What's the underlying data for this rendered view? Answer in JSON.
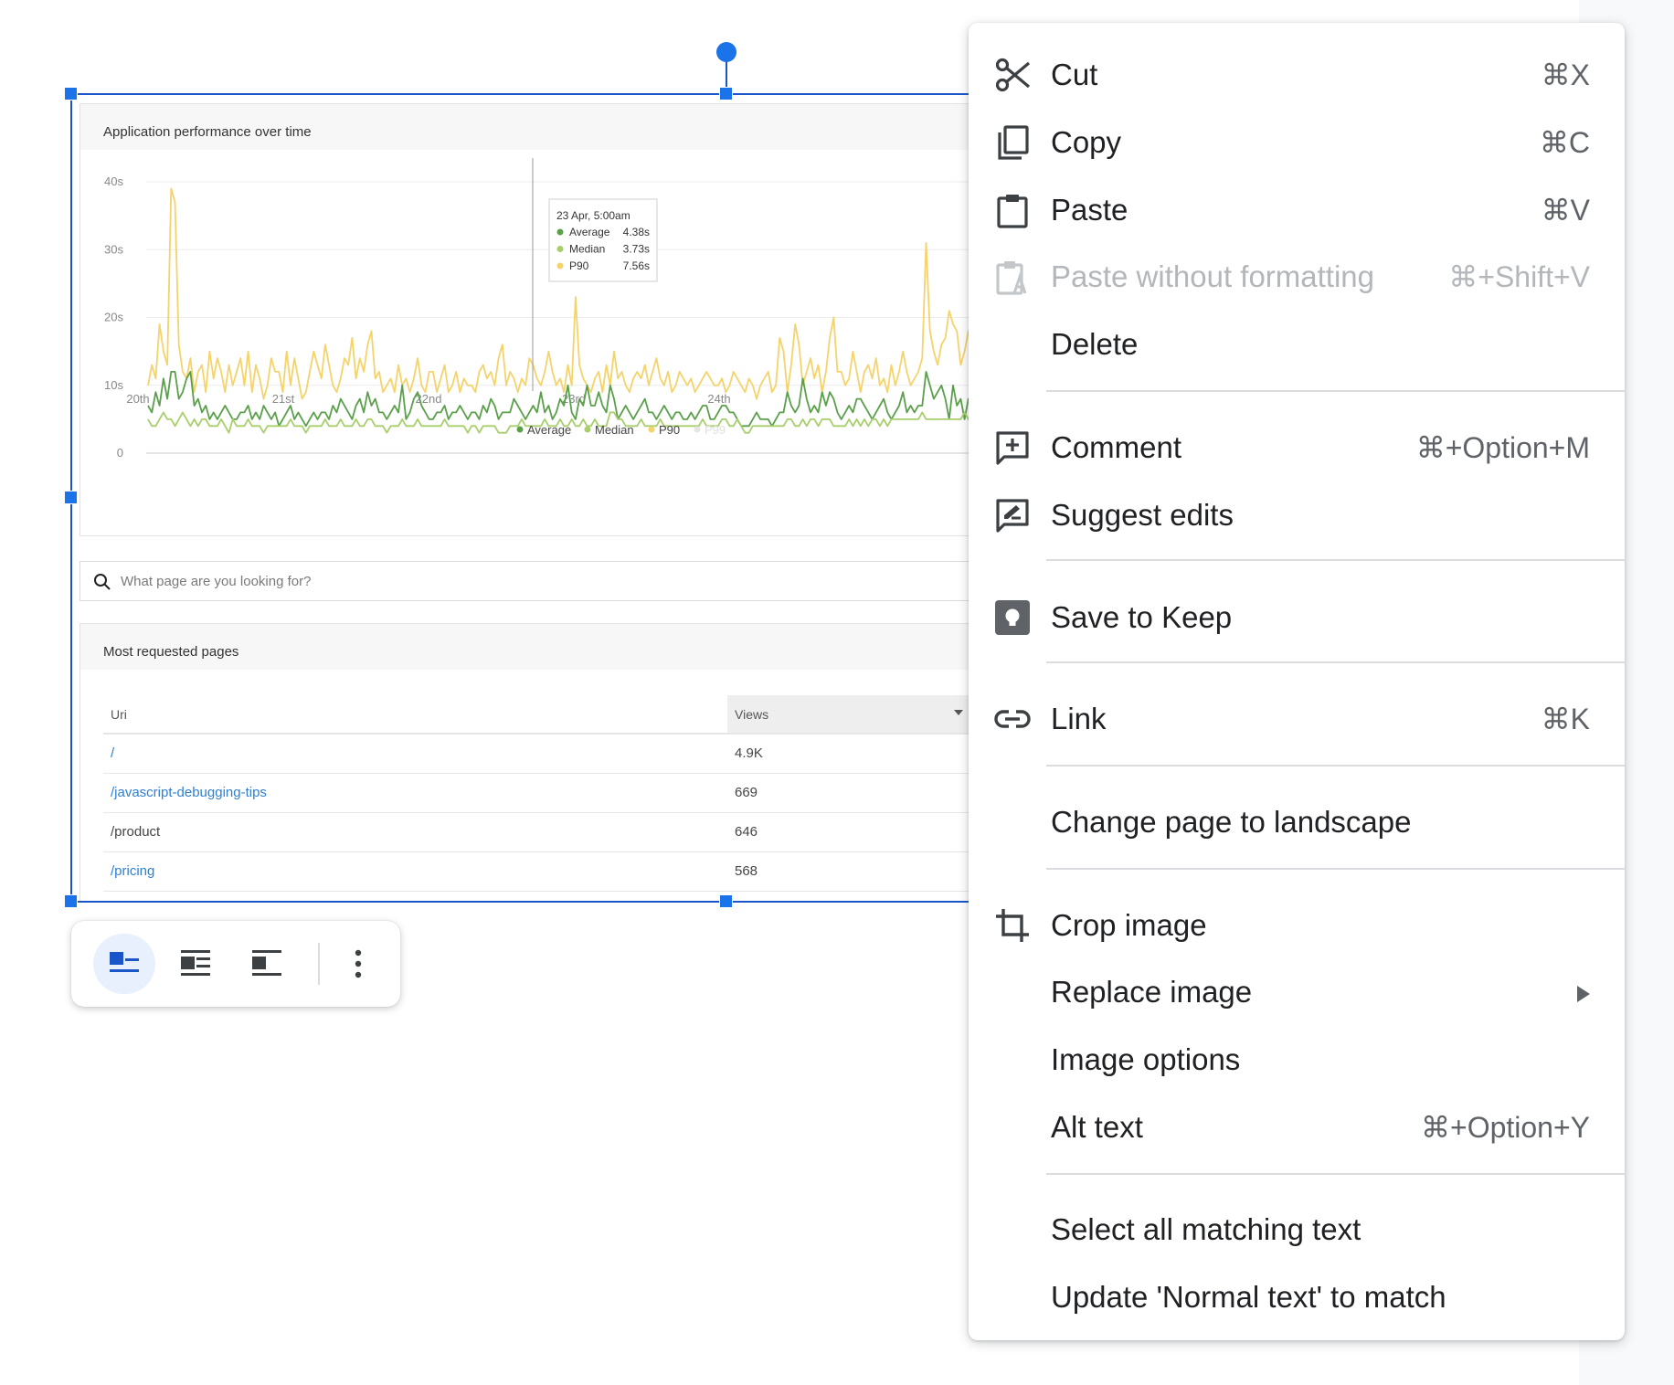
{
  "embedded_image": {
    "chart_card": {
      "title": "Application performance over time",
      "chart_data": {
        "type": "line",
        "x_ticks": [
          "20th",
          "21st",
          "22nd",
          "23rd",
          "24th"
        ],
        "y_ticks": [
          "0",
          "10s",
          "20s",
          "30s",
          "40s"
        ],
        "ylim": [
          0,
          40
        ],
        "grid": true,
        "legend_position": "bottom-center",
        "legend": [
          "Average",
          "Median",
          "P90",
          "P99"
        ],
        "series": [
          {
            "name": "P90",
            "color": "#f5d36b",
            "values": [
              10,
              13,
              11,
              19,
              15,
              13,
              39,
              37,
              16,
              12,
              11,
              14,
              9,
              12,
              13,
              9,
              15,
              11,
              14,
              12,
              9,
              13,
              10,
              12,
              14,
              10,
              15,
              9,
              13,
              11,
              8,
              10,
              14,
              12,
              12,
              9,
              15,
              10,
              14,
              11,
              8,
              9,
              12,
              15,
              13,
              11,
              16,
              13,
              10,
              9,
              11,
              14,
              13,
              17,
              11,
              14,
              12,
              16,
              18,
              11,
              12,
              9,
              10,
              11,
              9,
              13,
              10,
              11,
              9,
              11,
              14,
              10,
              9,
              12,
              12,
              9,
              11,
              13,
              9,
              10,
              12,
              9,
              11,
              10,
              10,
              9,
              12,
              13,
              11,
              12,
              10,
              14,
              16,
              10,
              12,
              11,
              9,
              11,
              10,
              14,
              13,
              11,
              10,
              12,
              15,
              12,
              10,
              11,
              9,
              13,
              10,
              23,
              13,
              11,
              10,
              9,
              11,
              12,
              9,
              13,
              10,
              15,
              11,
              12,
              10,
              9,
              11,
              12,
              11,
              13,
              10,
              12,
              14,
              11,
              10,
              12,
              9,
              10,
              12,
              11,
              10,
              11,
              9,
              10,
              11,
              12,
              11,
              10,
              10,
              11,
              9,
              10,
              12,
              11,
              10,
              9,
              11,
              10,
              8,
              10,
              11,
              12,
              9,
              10,
              17,
              15,
              9,
              13,
              19,
              16,
              10,
              12,
              14,
              11,
              13,
              9,
              12,
              17,
              20,
              12,
              12,
              10,
              11,
              15,
              12,
              9,
              12,
              13,
              11,
              14,
              10,
              11,
              9,
              13,
              10,
              12,
              15,
              12,
              10,
              11,
              12,
              14,
              31,
              18,
              15,
              13,
              16,
              17,
              21,
              19,
              18,
              13,
              15,
              18,
              15,
              16,
              19,
              14,
              20,
              18,
              12,
              12,
              17,
              13
            ]
          },
          {
            "name": "Average",
            "color": "#5aa04a",
            "values": [
              7,
              6,
              9,
              7,
              11,
              8,
              12,
              12,
              8,
              9,
              11,
              12,
              7,
              8,
              6,
              7,
              5,
              6,
              5,
              6,
              7,
              6,
              5,
              5,
              6,
              6,
              7,
              5,
              6,
              5,
              7,
              6,
              5,
              6,
              4,
              5,
              6,
              7,
              5,
              6,
              5,
              4,
              5,
              6,
              5,
              6,
              6,
              5,
              7,
              6,
              8,
              7,
              6,
              5,
              7,
              8,
              6,
              9,
              7,
              8,
              6,
              6,
              5,
              6,
              7,
              6,
              10,
              5,
              6,
              8,
              9,
              7,
              6,
              5,
              5,
              6,
              6,
              7,
              5,
              6,
              6,
              7,
              6,
              5,
              6,
              6,
              5,
              7,
              6,
              8,
              7,
              5,
              6,
              6,
              6,
              8,
              7,
              6,
              5,
              6,
              7,
              6,
              9,
              6,
              7,
              5,
              6,
              8,
              7,
              10,
              6,
              5,
              8,
              7,
              10,
              7,
              7,
              9,
              7,
              6,
              10,
              8,
              5,
              6,
              7,
              6,
              5,
              6,
              7,
              8,
              6,
              6,
              5,
              6,
              7,
              6,
              5,
              6,
              6,
              5,
              5,
              6,
              5,
              6,
              7,
              7,
              5,
              5,
              6,
              7,
              7,
              6,
              6,
              5,
              4,
              4,
              4,
              5,
              6,
              5,
              5,
              5,
              4,
              5,
              6,
              6,
              9,
              7,
              6,
              7,
              11,
              8,
              6,
              7,
              6,
              9,
              7,
              9,
              8,
              6,
              5,
              6,
              7,
              6,
              8,
              8,
              7,
              6,
              5,
              6,
              7,
              8,
              6,
              5,
              6,
              7,
              9,
              6,
              7,
              6,
              7,
              7,
              12,
              10,
              8,
              9,
              10,
              8,
              5,
              10,
              7,
              8,
              5,
              8,
              8,
              7,
              12,
              10,
              8,
              5,
              6,
              8,
              9,
              7
            ]
          },
          {
            "name": "Median",
            "color": "#a8cf6b",
            "values": [
              5,
              4,
              4,
              5,
              6,
              5,
              5,
              4,
              5,
              6,
              5,
              4,
              5,
              4,
              5,
              5,
              4,
              4,
              4,
              5,
              4,
              3,
              5,
              4,
              4,
              4,
              5,
              4,
              4,
              4,
              3,
              4,
              4,
              4,
              4,
              4,
              4,
              5,
              4,
              4,
              4,
              3,
              4,
              4,
              4,
              4,
              5,
              4,
              4,
              4,
              5,
              4,
              4,
              4,
              5,
              4,
              4,
              5,
              5,
              4,
              4,
              4,
              3,
              4,
              4,
              4,
              5,
              4,
              4,
              4,
              5,
              4,
              4,
              4,
              4,
              4,
              4,
              5,
              4,
              4,
              4,
              4,
              4,
              3,
              4,
              4,
              3,
              4,
              4,
              4,
              4,
              3,
              3,
              3,
              4,
              4,
              4,
              5,
              4,
              4,
              4,
              4,
              4,
              5,
              4,
              4,
              4,
              5,
              4,
              4,
              5,
              4,
              4,
              5,
              4,
              4,
              5,
              4,
              4,
              4,
              6,
              6,
              5,
              5,
              4,
              4,
              4,
              4,
              5,
              4,
              4,
              4,
              4,
              5,
              4,
              4,
              4,
              4,
              4,
              4,
              4,
              4,
              4,
              4,
              5,
              4,
              4,
              4,
              4,
              5,
              5,
              4,
              4,
              5,
              4,
              3,
              3,
              4,
              4,
              4,
              4,
              4,
              4,
              4,
              4,
              4,
              5,
              5,
              4,
              4,
              5,
              4,
              5,
              5,
              4,
              5,
              5,
              5,
              4,
              4,
              4,
              4,
              5,
              4,
              5,
              4,
              5,
              4,
              5,
              5,
              4,
              5,
              4,
              5,
              5,
              5,
              5,
              5,
              5,
              5,
              5,
              6,
              5,
              5,
              5,
              5,
              5,
              5,
              5,
              5,
              5,
              5,
              6,
              5,
              5,
              5,
              5,
              4,
              5,
              5,
              5,
              5,
              6,
              6
            ]
          }
        ],
        "tooltip": {
          "title": "23 Apr, 5:00am",
          "rows": [
            {
              "label": "Average",
              "value": "4.38s",
              "color": "#5aa04a"
            },
            {
              "label": "Median",
              "value": "3.73s",
              "color": "#a8cf6b"
            },
            {
              "label": "P90",
              "value": "7.56s",
              "color": "#f5d36b"
            }
          ]
        }
      }
    },
    "search": {
      "placeholder": "What page are you looking for?"
    },
    "table_card": {
      "title": "Most requested pages",
      "columns": [
        "Uri",
        "Views"
      ],
      "rows": [
        {
          "uri": "/",
          "views": "4.9K",
          "is_link": true
        },
        {
          "uri": "/javascript-debugging-tips",
          "views": "669",
          "is_link": true
        },
        {
          "uri": "/product",
          "views": "646",
          "is_link": false
        },
        {
          "uri": "/pricing",
          "views": "568",
          "is_link": true
        }
      ]
    }
  },
  "float_toolbar": {
    "buttons": [
      "wrap-inline-icon",
      "wrap-text-icon",
      "break-text-icon",
      "more-vert-icon"
    ],
    "active": "wrap-inline-icon"
  },
  "context_menu": {
    "items": {
      "cut": {
        "label": "Cut",
        "shortcut": "⌘X",
        "icon": "scissors-icon"
      },
      "copy": {
        "label": "Copy",
        "shortcut": "⌘C",
        "icon": "copy-icon"
      },
      "paste": {
        "label": "Paste",
        "shortcut": "⌘V",
        "icon": "clipboard-icon"
      },
      "paste_plain": {
        "label": "Paste without formatting",
        "shortcut": "⌘+Shift+V",
        "icon": "paste-plain-icon",
        "disabled": true
      },
      "delete": {
        "label": "Delete"
      },
      "comment": {
        "label": "Comment",
        "shortcut": "⌘+Option+M",
        "icon": "add-comment-icon"
      },
      "suggest": {
        "label": "Suggest edits",
        "icon": "rate-review-icon"
      },
      "keep": {
        "label": "Save to Keep",
        "icon": "keep-icon"
      },
      "link": {
        "label": "Link",
        "shortcut": "⌘K",
        "icon": "link-icon"
      },
      "landscape": {
        "label": "Change page to landscape"
      },
      "crop": {
        "label": "Crop image",
        "icon": "crop-icon"
      },
      "replace": {
        "label": "Replace image",
        "submenu": true
      },
      "options": {
        "label": "Image options"
      },
      "alt": {
        "label": "Alt text",
        "shortcut": "⌘+Option+Y"
      },
      "select_matching": {
        "label": "Select all matching text"
      },
      "update_style": {
        "label": "Update 'Normal text' to match"
      }
    }
  }
}
